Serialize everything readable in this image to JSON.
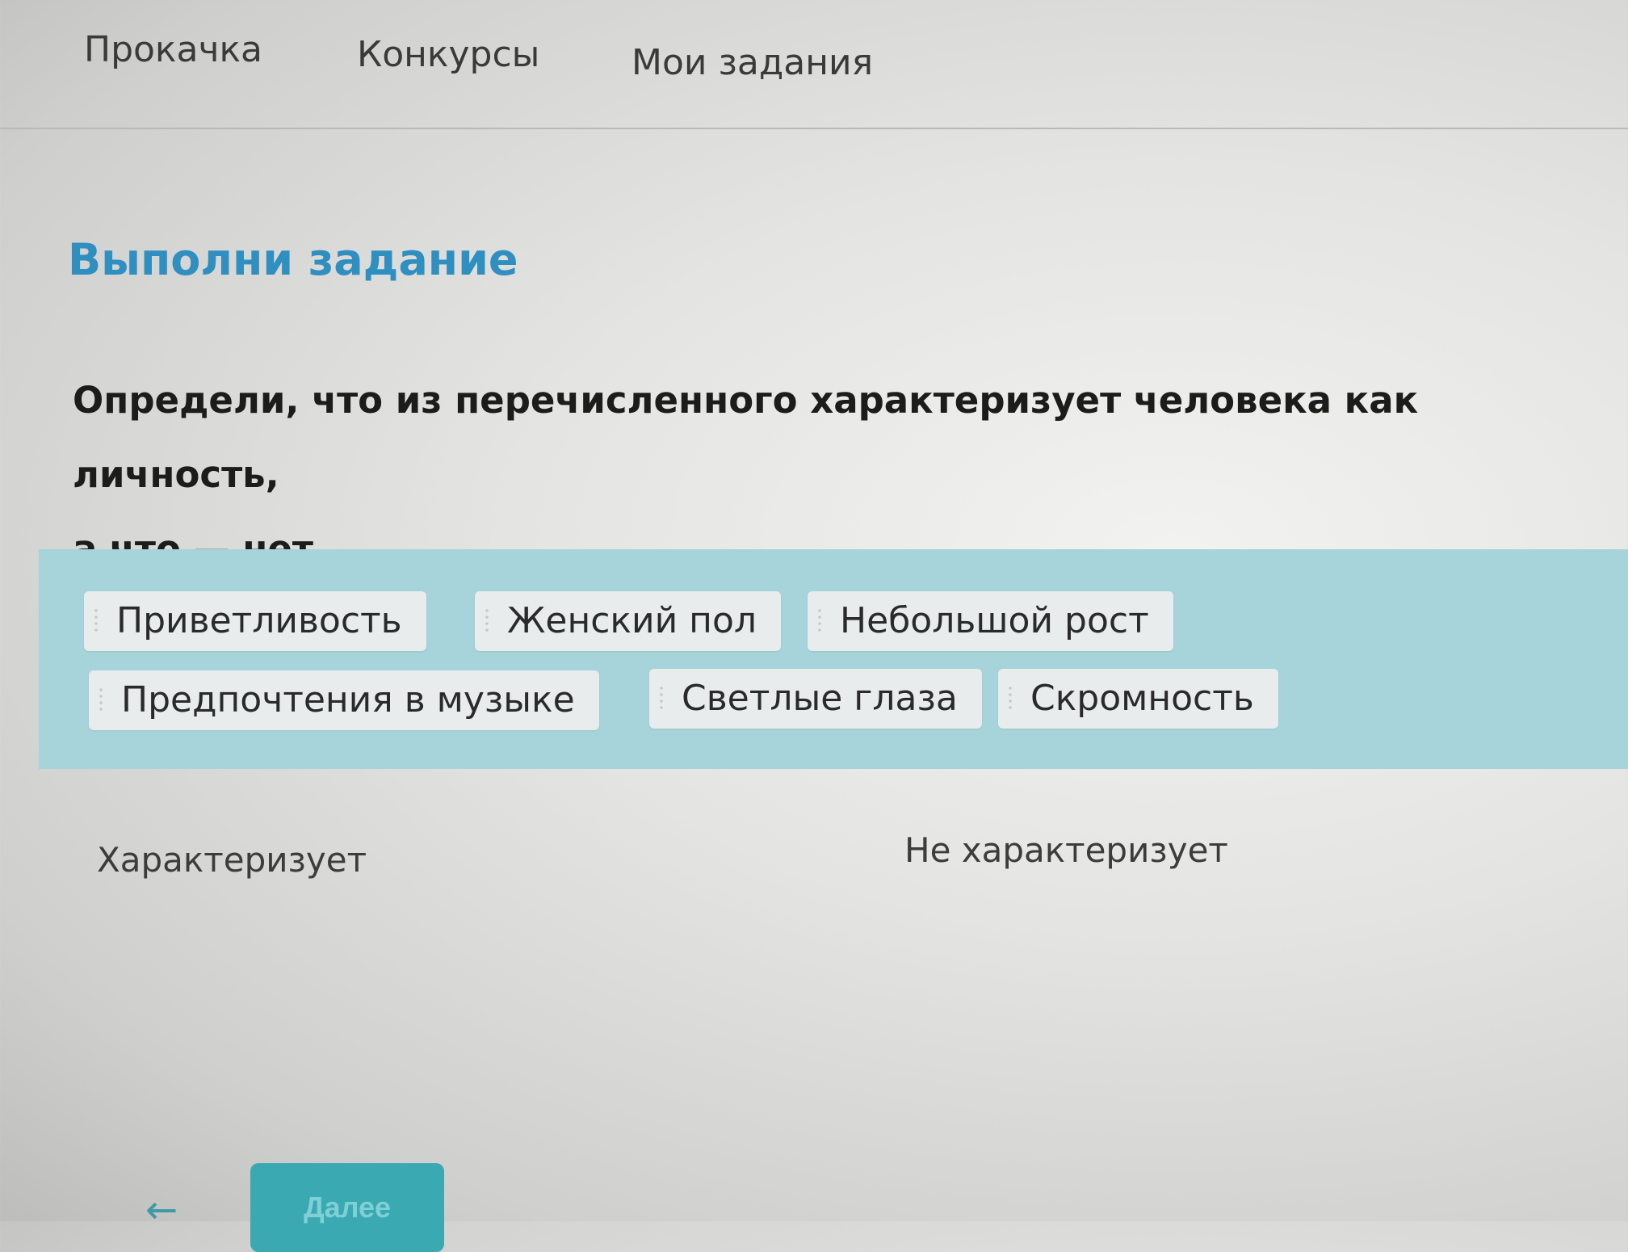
{
  "nav": {
    "items": [
      {
        "label": "Прокачка"
      },
      {
        "label": "Конкурсы"
      },
      {
        "label": "Мои задания"
      }
    ]
  },
  "task": {
    "title": "Выполни задание",
    "question_line1": "Определи, что из перечисленного характеризует человека как личность,",
    "question_line2": "а что — нет."
  },
  "word_bank": {
    "background_color": "#a7d4da",
    "chips": [
      {
        "label": "Приветливость"
      },
      {
        "label": "Женский пол"
      },
      {
        "label": "Небольшой рост"
      },
      {
        "label": "Предпочтения в музыке"
      },
      {
        "label": "Светлые глаза"
      },
      {
        "label": "Скромность"
      }
    ]
  },
  "columns": {
    "left_label": "Характеризует",
    "right_label": "Не характеризует"
  },
  "footer": {
    "back_icon": "arrow-left-icon",
    "back_glyph": "←",
    "next_label": "Далее",
    "accent_color": "#3aa9b2"
  }
}
